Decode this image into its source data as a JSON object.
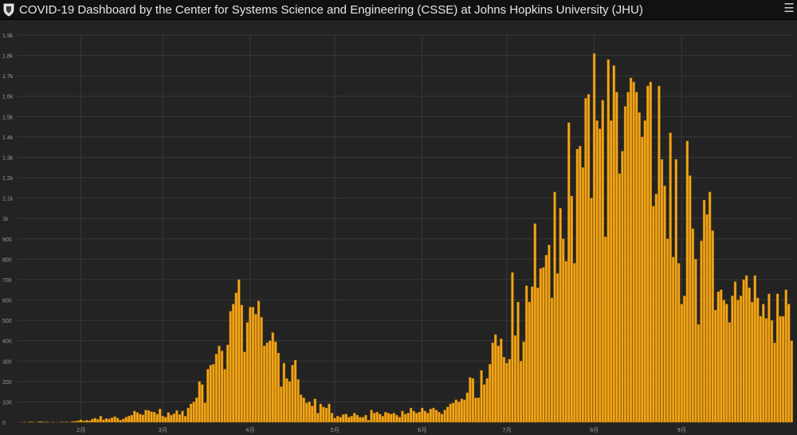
{
  "header": {
    "title": "COVID-19 Dashboard by the Center for Systems Science and Engineering (CSSE) at Johns Hopkins University (JHU)",
    "logo_icon": "shield-crest-icon",
    "menu_icon": "hamburger-menu-icon"
  },
  "colors": {
    "bar": "#f2a51a",
    "bar_edge": "#a86d00",
    "grid": "#383838",
    "text": "#9a9a9a",
    "background": "#232323",
    "header": "#111111"
  },
  "chart_data": {
    "type": "bar",
    "title": "",
    "xlabel": "",
    "ylabel": "",
    "ylim": [
      0,
      1900
    ],
    "y_ticks": [
      {
        "value": 0,
        "label": "0"
      },
      {
        "value": 100,
        "label": "100"
      },
      {
        "value": 200,
        "label": "200"
      },
      {
        "value": 300,
        "label": "300"
      },
      {
        "value": 400,
        "label": "400"
      },
      {
        "value": 500,
        "label": "500"
      },
      {
        "value": 600,
        "label": "600"
      },
      {
        "value": 700,
        "label": "700"
      },
      {
        "value": 800,
        "label": "800"
      },
      {
        "value": 900,
        "label": "900"
      },
      {
        "value": 1000,
        "label": "1k"
      },
      {
        "value": 1100,
        "label": "1.1k"
      },
      {
        "value": 1200,
        "label": "1.2k"
      },
      {
        "value": 1300,
        "label": "1.3k"
      },
      {
        "value": 1400,
        "label": "1.4k"
      },
      {
        "value": 1500,
        "label": "1.5k"
      },
      {
        "value": 1600,
        "label": "1.6k"
      },
      {
        "value": 1700,
        "label": "1.7k"
      },
      {
        "value": 1800,
        "label": "1.8k"
      },
      {
        "value": 1900,
        "label": "1.9k"
      }
    ],
    "x_ticks": [
      {
        "index": 22,
        "label": "2月"
      },
      {
        "index": 51,
        "label": "3月"
      },
      {
        "index": 82,
        "label": "4月"
      },
      {
        "index": 112,
        "label": "5月"
      },
      {
        "index": 143,
        "label": "6月"
      },
      {
        "index": 173,
        "label": "7月"
      },
      {
        "index": 204,
        "label": "8月"
      },
      {
        "index": 235,
        "label": "9月"
      }
    ],
    "grid": true,
    "values": [
      0,
      0,
      1,
      0,
      3,
      2,
      0,
      3,
      4,
      1,
      2,
      0,
      1,
      0,
      0,
      2,
      1,
      2,
      0,
      4,
      5,
      8,
      12,
      6,
      10,
      7,
      15,
      20,
      14,
      30,
      12,
      18,
      16,
      22,
      28,
      20,
      10,
      16,
      25,
      30,
      35,
      55,
      48,
      40,
      36,
      60,
      58,
      52,
      50,
      40,
      65,
      30,
      25,
      48,
      35,
      42,
      58,
      38,
      55,
      30,
      70,
      90,
      100,
      120,
      200,
      185,
      95,
      260,
      280,
      285,
      335,
      375,
      350,
      260,
      380,
      545,
      580,
      635,
      700,
      575,
      345,
      490,
      565,
      565,
      530,
      595,
      515,
      375,
      390,
      400,
      440,
      395,
      340,
      175,
      290,
      215,
      200,
      280,
      305,
      210,
      135,
      120,
      95,
      100,
      80,
      115,
      45,
      90,
      75,
      70,
      90,
      45,
      20,
      30,
      25,
      38,
      40,
      25,
      30,
      45,
      35,
      25,
      25,
      35,
      10,
      60,
      45,
      50,
      40,
      30,
      50,
      45,
      40,
      45,
      35,
      25,
      55,
      40,
      45,
      70,
      55,
      45,
      50,
      70,
      55,
      45,
      65,
      70,
      60,
      50,
      40,
      60,
      75,
      90,
      95,
      110,
      100,
      115,
      110,
      145,
      220,
      215,
      120,
      120,
      255,
      185,
      215,
      285,
      390,
      430,
      375,
      410,
      320,
      290,
      310,
      735,
      425,
      590,
      300,
      395,
      670,
      590,
      665,
      975,
      660,
      755,
      760,
      820,
      870,
      610,
      1130,
      730,
      1050,
      900,
      790,
      1470,
      1110,
      780,
      1340,
      1355,
      1250,
      1590,
      1610,
      1100,
      1810,
      1480,
      1440,
      1580,
      910,
      1780,
      1480,
      1750,
      1620,
      1220,
      1330,
      1550,
      1620,
      1690,
      1670,
      1620,
      1520,
      1400,
      1480,
      1650,
      1670,
      1060,
      1120,
      1650,
      1290,
      1160,
      900,
      1420,
      810,
      1290,
      780,
      580,
      620,
      1380,
      1210,
      950,
      800,
      480,
      890,
      1090,
      1020,
      1130,
      940,
      550,
      640,
      650,
      600,
      580,
      490,
      620,
      690,
      600,
      620,
      700,
      720,
      660,
      590,
      720,
      610,
      520,
      580,
      510,
      630,
      500,
      390,
      630,
      520,
      520,
      650,
      580,
      400
    ]
  }
}
